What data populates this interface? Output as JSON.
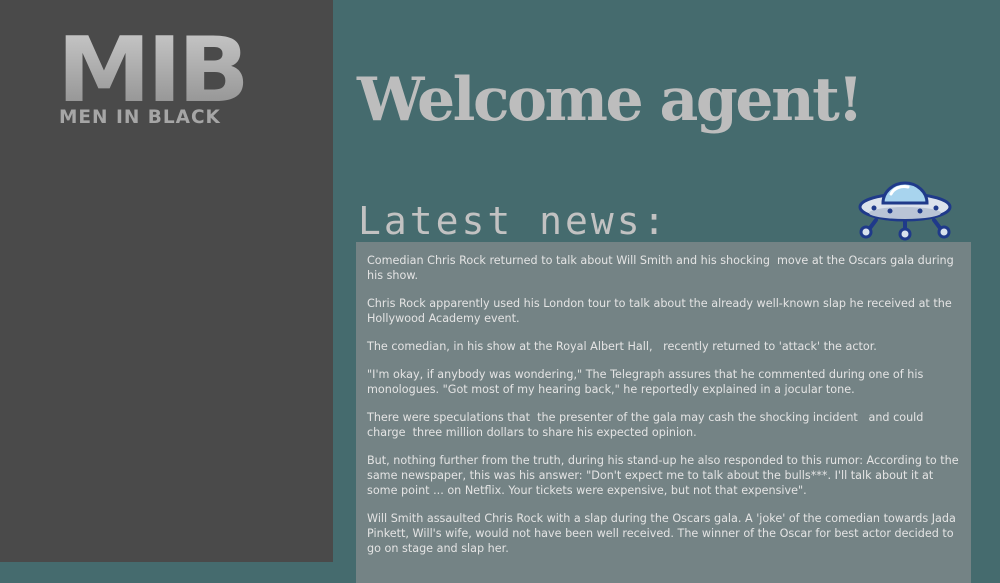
{
  "logo": {
    "main": "MIB",
    "subtitle": "MEN IN BLACK"
  },
  "header": {
    "title": "Welcome agent!"
  },
  "news": {
    "heading": "Latest news:",
    "paragraphs": [
      "Comedian Chris Rock returned to talk about Will Smith and his shocking  move at the Oscars gala during his show.",
      "Chris Rock apparently used his London tour to talk about the already well-known slap he received at the Hollywood Academy event.",
      "The comedian, in his show at the Royal Albert Hall,   recently returned to 'attack' the actor.",
      "\"I'm okay, if anybody was wondering,\" The Telegraph assures that he commented during one of his monologues. \"Got most of my hearing back,\" he reportedly explained in a jocular tone.",
      "There were speculations that  the presenter of the gala may cash the shocking incident   and could charge  three million dollars to share his expected opinion.",
      "But, nothing further from the truth, during his stand-up he also responded to this rumor: According to the same newspaper, this was his answer: \"Don't expect me to talk about the bulls***. I'll talk about it at some point ... on Netflix. Your tickets were expensive, but not that expensive\".",
      "Will Smith assaulted Chris Rock with a slap during the Oscars gala. A 'joke' of the comedian towards Jada Pinkett, Will's wife, would not have been well received. The winner of the Oscar for best actor decided to go on stage and slap her."
    ]
  },
  "colors": {
    "sidebar": "#4a4a4a",
    "main_background": "#456b6e",
    "news_box": "#748385",
    "ufo_body": "#1f3a8a"
  },
  "icons": {
    "ufo": "flying-saucer-icon"
  }
}
